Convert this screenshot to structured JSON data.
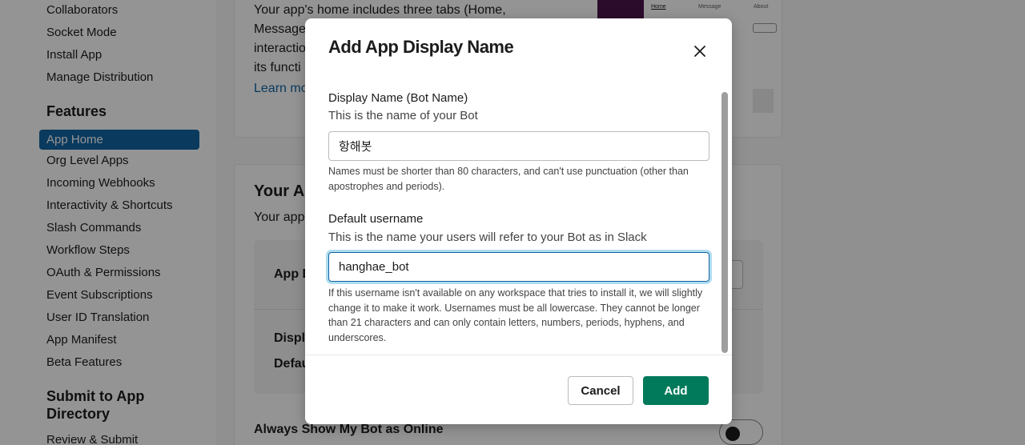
{
  "sidebar": {
    "items_top": [
      "Collaborators",
      "Socket Mode",
      "Install App",
      "Manage Distribution"
    ],
    "features_heading": "Features",
    "features_items": [
      "App Home",
      "Org Level Apps",
      "Incoming Webhooks",
      "Interactivity & Shortcuts",
      "Slash Commands",
      "Workflow Steps",
      "OAuth & Permissions",
      "Event Subscriptions",
      "User ID Translation",
      "App Manifest",
      "Beta Features"
    ],
    "submit_heading": "Submit to App Directory",
    "submit_items": [
      "Review & Submit"
    ]
  },
  "background": {
    "intro_lines": [
      "Your app's home includes three tabs (Home,",
      "Message",
      "interactio",
      "its functi"
    ],
    "learn_more": "Learn mo",
    "preview_tabs": [
      "Home",
      "Message",
      "About"
    ],
    "section_title": "Your Ap",
    "section_sub": "Your app",
    "app_display_label": "App D",
    "display_label": "Displ",
    "default_label": "Defau",
    "always_online": "Always Show My Bot as Online"
  },
  "modal": {
    "title": "Add App Display Name",
    "display_name_label": "Display Name (Bot Name)",
    "display_name_sub": "This is the name of your Bot",
    "display_name_value": "항해봇",
    "display_name_hint": "Names must be shorter than 80 characters, and can't use punctuation (other than apostrophes and periods).",
    "username_label": "Default username",
    "username_sub": "This is the name your users will refer to your Bot as in Slack",
    "username_value": "hanghae_bot",
    "username_hint": "If this username isn't available on any workspace that tries to install it, we will slightly change it to make it work. Usernames must be all lowercase. They cannot be longer than 21 characters and can only contain letters, numbers, periods, hyphens, and underscores.",
    "cancel_label": "Cancel",
    "add_label": "Add"
  },
  "colors": {
    "accent": "#1264a3",
    "primary_button": "#007a5a",
    "overlay": "rgba(0,0,0,0.42)"
  }
}
